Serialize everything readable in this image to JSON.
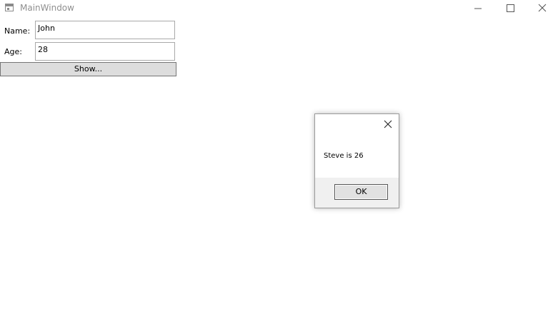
{
  "window": {
    "title": "MainWindow",
    "icons": {
      "app": "window-icon",
      "minimize": "minimize-icon",
      "maximize": "maximize-icon",
      "close": "close-icon"
    }
  },
  "form": {
    "name_label": "Name:",
    "name_value": "John",
    "age_label": "Age:",
    "age_value": "28",
    "show_button": "Show..."
  },
  "message_box": {
    "message": "Steve is 26",
    "ok_button": "OK",
    "close_icon": "close-icon"
  },
  "colors": {
    "title_text": "#8f8f8f",
    "button_face": "#dddddd",
    "dialog_footer": "#f0f0f0"
  }
}
